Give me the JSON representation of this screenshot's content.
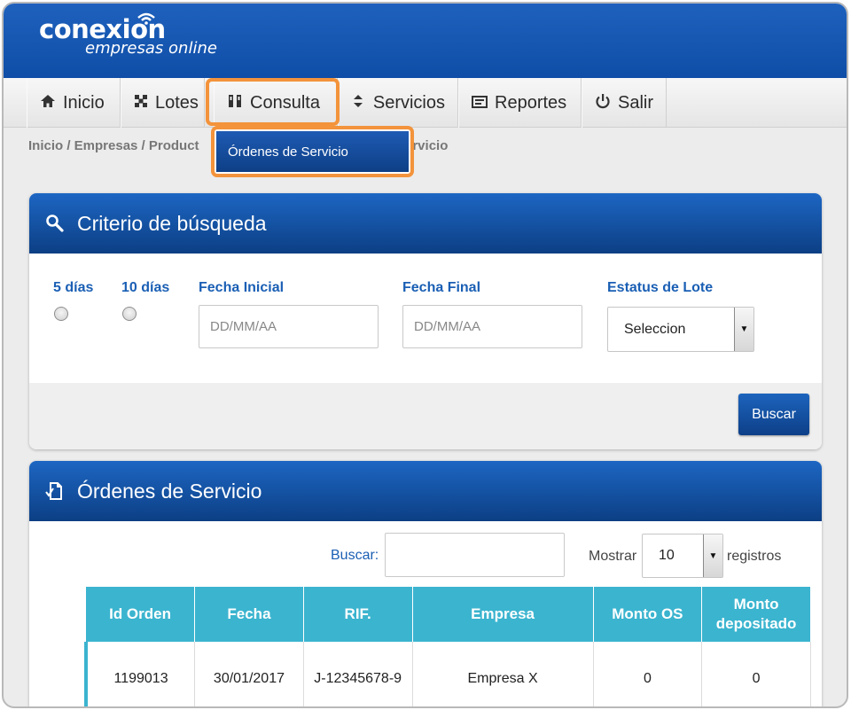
{
  "brand": {
    "name": "conexion",
    "subtitle": "empresas online"
  },
  "nav": {
    "items": [
      {
        "label": "Inicio",
        "icon": "home-icon"
      },
      {
        "label": "Lotes",
        "icon": "lotes-icon"
      },
      {
        "label": "Consulta",
        "icon": "consulta-icon"
      },
      {
        "label": "Servicios",
        "icon": "servicios-icon"
      },
      {
        "label": "Reportes",
        "icon": "reportes-icon"
      },
      {
        "label": "Salir",
        "icon": "power-icon"
      }
    ]
  },
  "breadcrumb": {
    "text": "Inicio / Empresas / Product",
    "tail": "ervicio"
  },
  "dropdown": {
    "item": "Órdenes de Servicio"
  },
  "search_panel": {
    "title": "Criterio de búsqueda",
    "radio_5": "5 días",
    "radio_10": "10 días",
    "fecha_inicial_label": "Fecha Inicial",
    "fecha_inicial_placeholder": "DD/MM/AA",
    "fecha_final_label": "Fecha Final",
    "fecha_final_placeholder": "DD/MM/AA",
    "estatus_label": "Estatus de Lote",
    "estatus_value": "Seleccion",
    "buscar_button": "Buscar"
  },
  "orders_panel": {
    "title": "Órdenes de Servicio",
    "buscar_label": "Buscar:",
    "mostrar_label": "Mostrar",
    "mostrar_value": "10",
    "registros_label": "registros",
    "columns": [
      "Id Orden",
      "Fecha",
      "RIF.",
      "Empresa",
      "Monto OS",
      "Monto depositado"
    ],
    "rows": [
      {
        "id": "1199013",
        "fecha": "30/01/2017",
        "rif": "J-12345678-9",
        "empresa": "Empresa X",
        "monto_os": "0",
        "monto_dep": "0"
      }
    ]
  },
  "colors": {
    "primary": "#0f4ea7",
    "accent": "#f3933b",
    "table_header": "#3bb4cf"
  }
}
